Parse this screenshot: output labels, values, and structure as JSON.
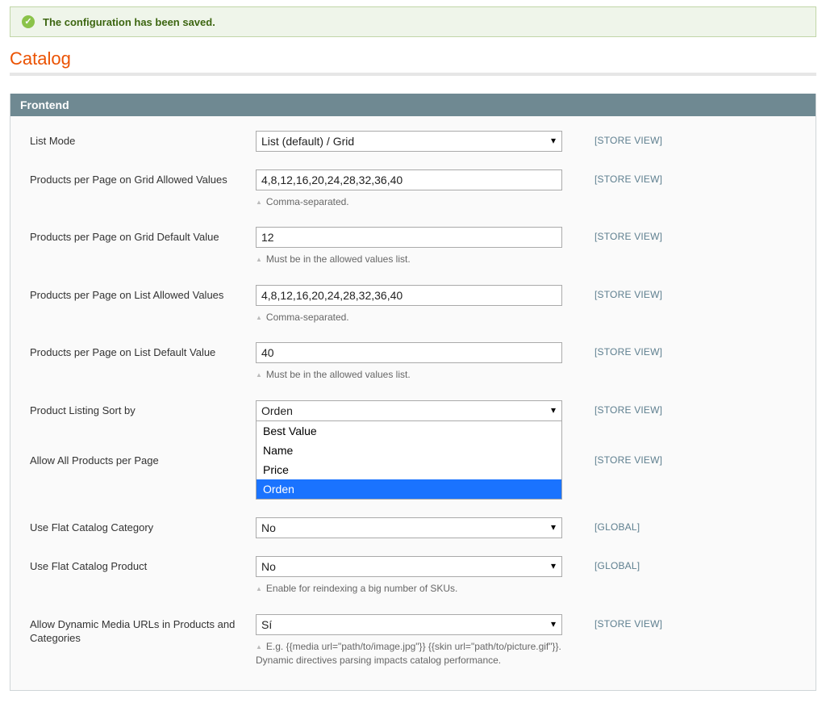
{
  "notice": {
    "text": "The configuration has been saved."
  },
  "page_title": "Catalog",
  "section": {
    "title": "Frontend"
  },
  "scopes": {
    "store_view": "[STORE VIEW]",
    "global": "[GLOBAL]"
  },
  "fields": {
    "list_mode": {
      "label": "List Mode",
      "selected": "List (default) / Grid",
      "scope": "store_view"
    },
    "grid_allowed": {
      "label": "Products per Page on Grid Allowed Values",
      "value": "4,8,12,16,20,24,28,32,36,40",
      "hint": "Comma-separated.",
      "scope": "store_view"
    },
    "grid_default": {
      "label": "Products per Page on Grid Default Value",
      "value": "12",
      "hint": "Must be in the allowed values list.",
      "scope": "store_view"
    },
    "list_allowed": {
      "label": "Products per Page on List Allowed Values",
      "value": "4,8,12,16,20,24,28,32,36,40",
      "hint": "Comma-separated.",
      "scope": "store_view"
    },
    "list_default": {
      "label": "Products per Page on List Default Value",
      "value": "40",
      "hint": "Must be in the allowed values list.",
      "scope": "store_view"
    },
    "sort_by": {
      "label": "Product Listing Sort by",
      "selected": "Orden",
      "options": [
        "Best Value",
        "Name",
        "Price",
        "Orden"
      ],
      "scope": "store_view"
    },
    "allow_all": {
      "label": "Allow All Products per Page",
      "scope": "store_view"
    },
    "flat_category": {
      "label": "Use Flat Catalog Category",
      "selected": "No",
      "scope": "global"
    },
    "flat_product": {
      "label": "Use Flat Catalog Product",
      "selected": "No",
      "hint": "Enable for reindexing a big number of SKUs.",
      "scope": "global"
    },
    "dynamic_media": {
      "label": "Allow Dynamic Media URLs in Products and Categories",
      "selected": "Sí",
      "hint": "E.g. {{media url=\"path/to/image.jpg\"}} {{skin url=\"path/to/picture.gif\"}}. Dynamic directives parsing impacts catalog performance.",
      "scope": "store_view"
    }
  }
}
